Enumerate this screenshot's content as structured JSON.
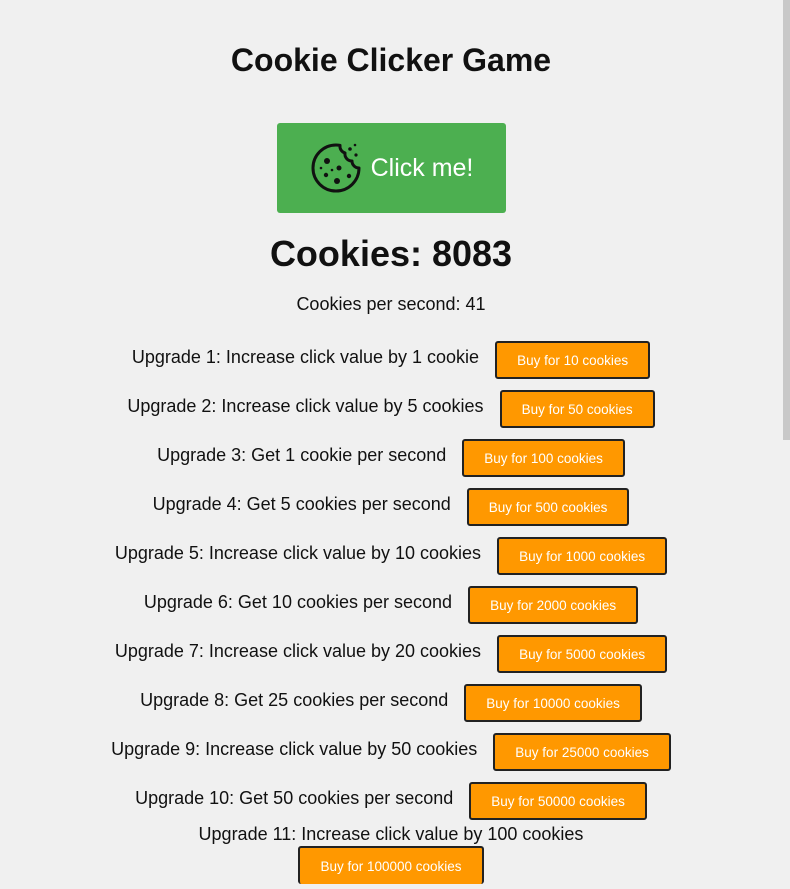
{
  "title": "Cookie Clicker Game",
  "click_button": {
    "icon": "cookie-icon",
    "label": "Click me!"
  },
  "cookies": {
    "label": "Cookies: 8083"
  },
  "cps": {
    "label": "Cookies per second: 41"
  },
  "upgrades": [
    {
      "label": "Upgrade 1: Increase click value by 1 cookie",
      "button": "Buy for 10 cookies"
    },
    {
      "label": "Upgrade 2: Increase click value by 5 cookies",
      "button": "Buy for 50 cookies"
    },
    {
      "label": "Upgrade 3: Get 1 cookie per second",
      "button": "Buy for 100 cookies"
    },
    {
      "label": "Upgrade 4: Get 5 cookies per second",
      "button": "Buy for 500 cookies"
    },
    {
      "label": "Upgrade 5: Increase click value by 10 cookies",
      "button": "Buy for 1000 cookies"
    },
    {
      "label": "Upgrade 6: Get 10 cookies per second",
      "button": "Buy for 2000 cookies"
    },
    {
      "label": "Upgrade 7: Increase click value by 20 cookies",
      "button": "Buy for 5000 cookies"
    },
    {
      "label": "Upgrade 8: Get 25 cookies per second",
      "button": "Buy for 10000 cookies"
    },
    {
      "label": "Upgrade 9: Increase click value by 50 cookies",
      "button": "Buy for 25000 cookies"
    },
    {
      "label": "Upgrade 10: Get 50 cookies per second",
      "button": "Buy for 50000 cookies"
    },
    {
      "label": "Upgrade 11: Increase click value by 100 cookies",
      "button": "Buy for 100000 cookies"
    }
  ],
  "colors": {
    "background": "#f0f0f0",
    "click_button": "#4caf50",
    "buy_button": "#ff9800",
    "text": "#111111"
  }
}
